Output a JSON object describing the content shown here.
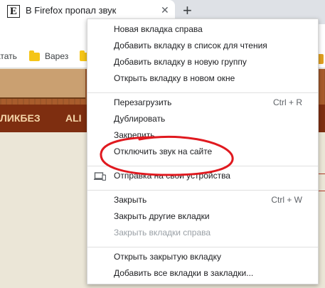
{
  "browser": {
    "tab": {
      "favicon_letter": "E",
      "title": "В Firefox пропал звук",
      "close_glyph": "✕"
    },
    "new_tab_glyph": "+",
    "bookmarks": [
      {
        "label": "атать",
        "icon": "none"
      },
      {
        "label": "Варез",
        "icon": "folder-icon"
      }
    ]
  },
  "page": {
    "nav": [
      "ЛИКБЕЗ",
      "ALI"
    ]
  },
  "context_menu": {
    "groups": [
      [
        {
          "label": "Новая вкладка справа"
        },
        {
          "label": "Добавить вкладку в список для чтения"
        },
        {
          "label": "Добавить вкладку в новую группу"
        },
        {
          "label": "Открыть вкладку в новом окне"
        }
      ],
      [
        {
          "label": "Перезагрузить",
          "shortcut": "Ctrl + R"
        },
        {
          "label": "Дублировать"
        },
        {
          "label": "Закрепить"
        },
        {
          "label": "Отключить звук на сайте"
        }
      ],
      [
        {
          "label": "Отправка на свои устройства",
          "icon": "devices-icon"
        }
      ],
      [
        {
          "label": "Закрыть",
          "shortcut": "Ctrl + W"
        },
        {
          "label": "Закрыть другие вкладки"
        },
        {
          "label": "Закрыть вкладки справа",
          "disabled": true
        }
      ],
      [
        {
          "label": "Открыть закрытую вкладку"
        },
        {
          "label": "Добавить все вкладки в закладки..."
        }
      ]
    ]
  },
  "annotation": {
    "color": "#e0191f",
    "circled_item": "Отключить звук на сайте"
  }
}
